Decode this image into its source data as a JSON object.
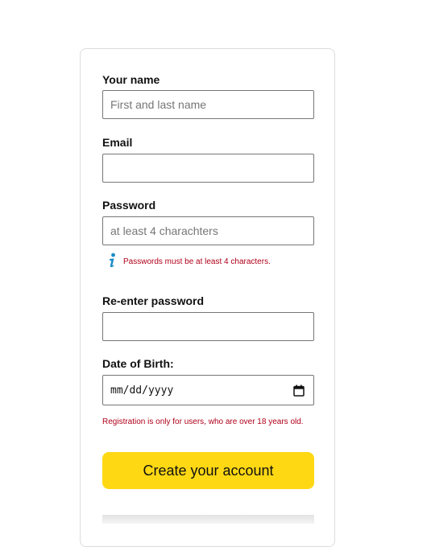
{
  "form": {
    "name": {
      "label": "Your name",
      "value": "",
      "placeholder": "First and last name"
    },
    "email": {
      "label": "Email",
      "value": "",
      "placeholder": ""
    },
    "password": {
      "label": "Password",
      "value": "",
      "placeholder": "at least 4 charachters",
      "hint_icon": "info-icon",
      "hint": "Passwords must be at least 4 characters."
    },
    "password_confirm": {
      "label": "Re-enter password",
      "value": "",
      "placeholder": ""
    },
    "dob": {
      "label": "Date of Birth:",
      "placeholder": "mm/dd/yyyy",
      "icon": "calendar-icon",
      "note": "Registration is only for users, who are over 18 years old."
    },
    "submit_label": "Create your account"
  },
  "colors": {
    "button": "#ffd814",
    "error": "#b0001a",
    "info_icon": "#1a8bc6",
    "border": "#767676"
  }
}
